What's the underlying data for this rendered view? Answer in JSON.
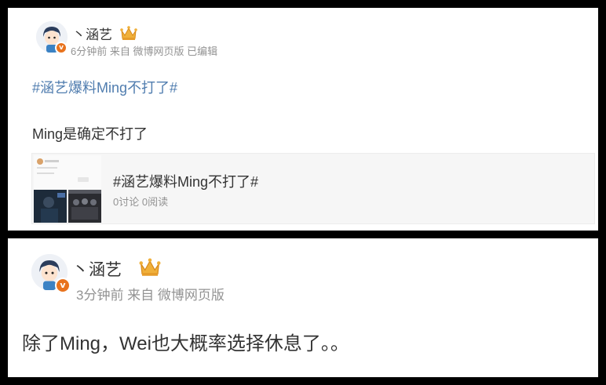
{
  "posts": [
    {
      "author": "丶涵艺",
      "verified_badge": "v",
      "meta": "6分钟前 来自 微博网页版 已编辑",
      "topic": "#涵艺爆料Ming不打了#",
      "text": "Ming是确定不打了",
      "topic_card": {
        "title": "#涵艺爆料Ming不打了#",
        "stats": "0讨论 0阅读"
      }
    },
    {
      "author": "丶涵艺",
      "verified_badge": "v",
      "meta": "3分钟前 来自 微博网页版",
      "text": "除了Ming，Wei也大概率选择休息了。。"
    }
  ],
  "colors": {
    "topic_link": "#507daf",
    "meta_gray": "#939393",
    "badge_orange": "#e8731e",
    "crown_gold": "#f0b03a"
  },
  "icons": [
    "avatar",
    "verified-badge-icon",
    "crown-icon"
  ]
}
